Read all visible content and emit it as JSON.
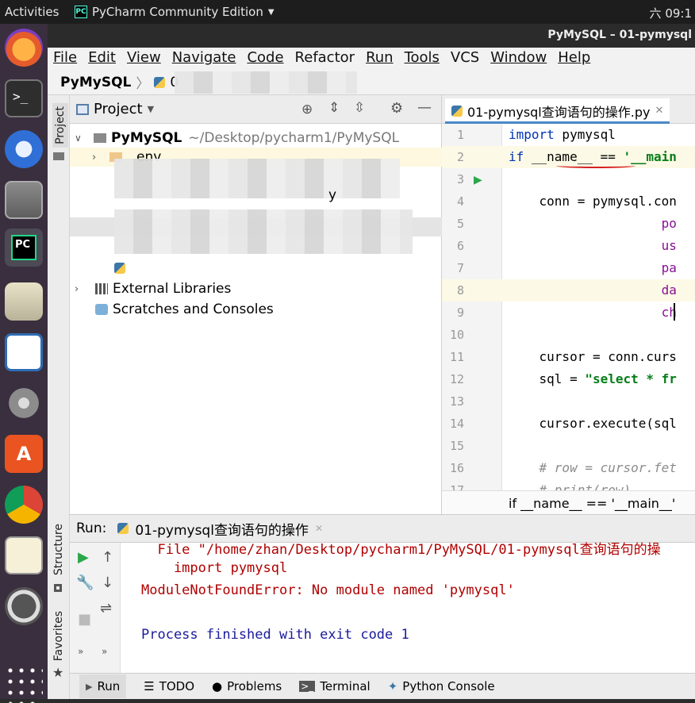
{
  "topbar": {
    "activities": "Activities",
    "app_name": "PyCharm Community Edition",
    "clock": "六 09:1"
  },
  "window": {
    "title": "PyMySQL – 01-pymysql"
  },
  "menu": [
    "File",
    "Edit",
    "View",
    "Navigate",
    "Code",
    "Refactor",
    "Run",
    "Tools",
    "VCS",
    "Window",
    "Help"
  ],
  "navbar": {
    "project": "PyMySQL",
    "file_partial": "0"
  },
  "side_tabs": {
    "project": "Project",
    "structure": "Structure",
    "favorites": "Favorites"
  },
  "project_panel": {
    "title": "Project",
    "root_name": "PyMySQL",
    "root_path": "~/Desktop/pycharm1/PyMySQL",
    "venv_partial": "env",
    "file_partial_suffix": "y",
    "external_libraries": "External Libraries",
    "scratches": "Scratches and Consoles"
  },
  "editor": {
    "tab_label": "01-pymysql查询语句的操作.py",
    "lines": [
      {
        "n": "1",
        "parts": [
          {
            "c": "kw",
            "t": "import"
          },
          {
            "c": "",
            "t": " pymysql"
          }
        ]
      },
      {
        "n": "2",
        "parts": [
          {
            "c": "kw",
            "t": "if"
          },
          {
            "c": "",
            "t": " __name__ == "
          },
          {
            "c": "str",
            "t": "'__main"
          }
        ]
      },
      {
        "n": "3",
        "parts": []
      },
      {
        "n": "4",
        "parts": [
          {
            "c": "",
            "t": "    conn = pymysql.con"
          }
        ]
      },
      {
        "n": "5",
        "parts": [
          {
            "c": "param",
            "t": "                    po"
          }
        ]
      },
      {
        "n": "6",
        "parts": [
          {
            "c": "param",
            "t": "                    us"
          }
        ]
      },
      {
        "n": "7",
        "parts": [
          {
            "c": "param",
            "t": "                    pa"
          }
        ]
      },
      {
        "n": "8",
        "parts": [
          {
            "c": "param",
            "t": "                    da"
          }
        ]
      },
      {
        "n": "9",
        "parts": [
          {
            "c": "param",
            "t": "                    ch"
          }
        ]
      },
      {
        "n": "10",
        "parts": []
      },
      {
        "n": "11",
        "parts": [
          {
            "c": "",
            "t": "    cursor = conn.curs"
          }
        ]
      },
      {
        "n": "12",
        "parts": [
          {
            "c": "",
            "t": "    sql = "
          },
          {
            "c": "str",
            "t": "\"select * fr"
          }
        ]
      },
      {
        "n": "13",
        "parts": []
      },
      {
        "n": "14",
        "parts": [
          {
            "c": "",
            "t": "    cursor.execute(sql"
          }
        ]
      },
      {
        "n": "15",
        "parts": []
      },
      {
        "n": "16",
        "parts": [
          {
            "c": "cm",
            "t": "    # row = cursor.fet"
          }
        ]
      },
      {
        "n": "17",
        "parts": [
          {
            "c": "cm",
            "t": "    # print(row)"
          }
        ]
      }
    ],
    "breadcrumb": "if __name__ == '__main__'"
  },
  "run_panel": {
    "label": "Run:",
    "tab": "01-pymysql查询语句的操作",
    "output": [
      {
        "t": "  File \"/home/zhan/Desktop/pycharm1/PyMySQL/01-pymysql查询语句的操",
        "c": "#b00000"
      },
      {
        "t": "    import pymysql",
        "c": "#b00000"
      },
      {
        "t": "ModuleNotFoundError: No module named 'pymysql'",
        "c": "#b00000"
      },
      {
        "t": "",
        "c": "#000"
      },
      {
        "t": "Process finished with exit code 1",
        "c": "#1a1a9c"
      }
    ]
  },
  "bottom_tabs": [
    "Run",
    "TODO",
    "Problems",
    "Terminal",
    "Python Console"
  ]
}
